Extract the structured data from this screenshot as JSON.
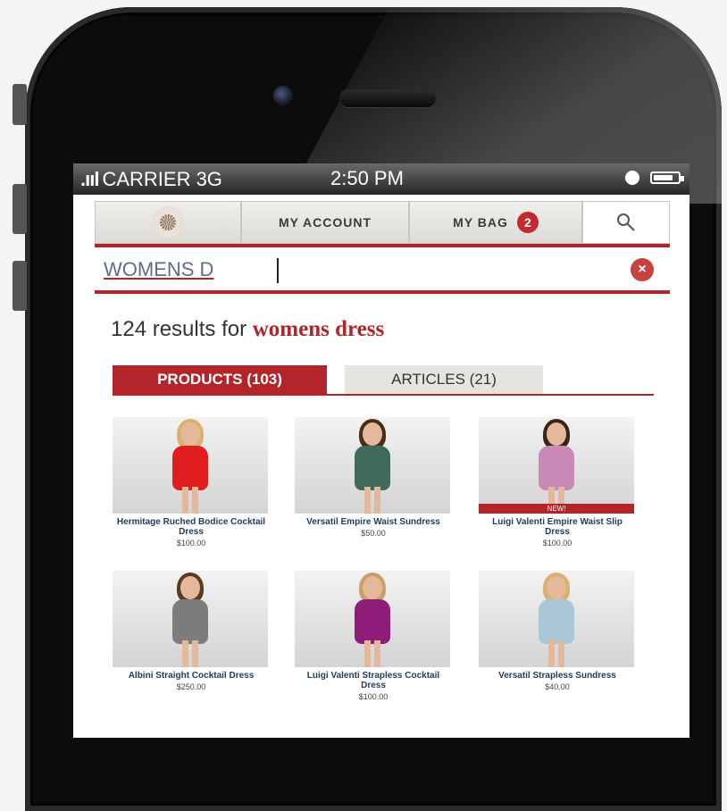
{
  "status_bar": {
    "signal": ".ııl",
    "carrier": "CARRIER 3G",
    "time": "2:50 PM"
  },
  "nav": {
    "account_label": "MY ACCOUNT",
    "bag_label": "MY BAG",
    "bag_count": "2"
  },
  "search": {
    "value": "WOMENS D",
    "clear_icon": "×"
  },
  "results": {
    "count_text": "124 results for",
    "query": "womens dress"
  },
  "tabs": [
    {
      "label": "PRODUCTS (103)",
      "active": true
    },
    {
      "label": "ARTICLES (21)",
      "active": false
    }
  ],
  "products": [
    {
      "name": "Hermitage Ruched Bodice Cocktail Dress",
      "price": "$100.00",
      "dress_color": "#e01e20",
      "hair_color": "#d9b36a",
      "badge": ""
    },
    {
      "name": "Versatil Empire Waist Sundress",
      "price": "$50.00",
      "dress_color": "#3f6b5a",
      "hair_color": "#4a2c1a",
      "badge": ""
    },
    {
      "name": "Luigi Valenti Empire Waist Slip Dress",
      "price": "$100.00",
      "dress_color": "#c98ab8",
      "hair_color": "#3a2418",
      "badge": "NEW!"
    },
    {
      "name": "Albini Straight Cocktail Dress",
      "price": "$250.00",
      "dress_color": "#7c7c7c",
      "hair_color": "#5a3a22",
      "badge": ""
    },
    {
      "name": "Luigi Valenti Strapless Cocktail Dress",
      "price": "$100.00",
      "dress_color": "#8e1d7a",
      "hair_color": "#c9a06a",
      "badge": ""
    },
    {
      "name": "Versatil Strapless Sundress",
      "price": "$40.00",
      "dress_color": "#a9c7d6",
      "hair_color": "#d8b070",
      "badge": ""
    }
  ]
}
